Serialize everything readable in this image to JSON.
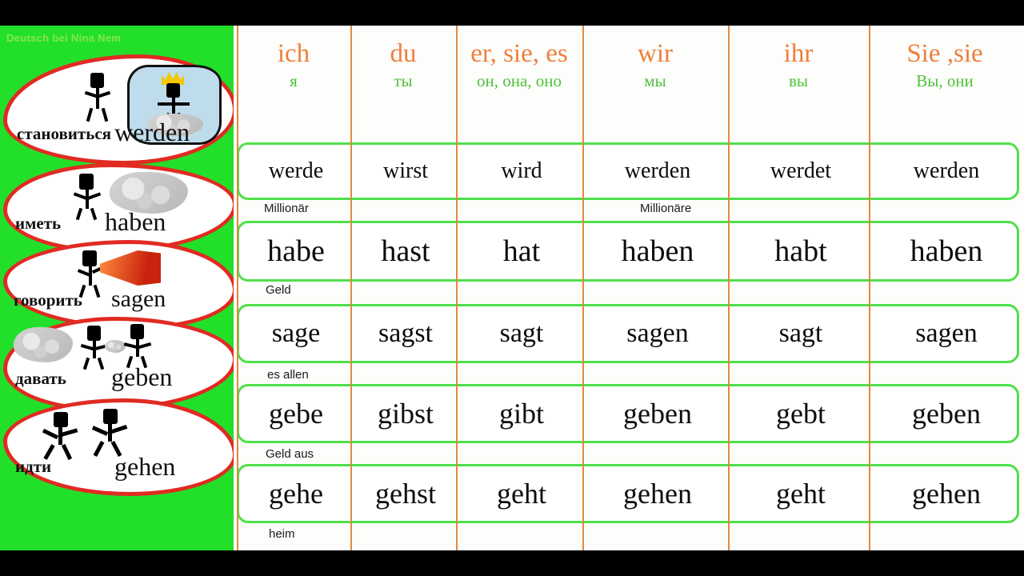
{
  "watermark": "Deutsch bei Nina Nem",
  "colors": {
    "sidebar_green": "#22e02a",
    "pronoun_orange": "#ef7f3d",
    "russian_green": "#4fc23a",
    "row_border_green": "#4fe04a",
    "column_divider": "#e08a3c",
    "card_outline_red": "#e02b22"
  },
  "header": {
    "columns": [
      {
        "pronoun": "ich",
        "russian": "я"
      },
      {
        "pronoun": "du",
        "russian": "ты"
      },
      {
        "pronoun": "er, sie, es",
        "russian": "он, она, оно"
      },
      {
        "pronoun": "wir",
        "russian": "мы"
      },
      {
        "pronoun": "ihr",
        "russian": "вы"
      },
      {
        "pronoun": "Sie ,sie",
        "russian": "Вы, они"
      }
    ]
  },
  "verbs": [
    {
      "infinitive": "werden",
      "russian": "становиться",
      "icon": "stick-figure-thinking-of-crowned-millionaire",
      "forms": [
        "werde",
        "wirst",
        "wird",
        "werden",
        "werdet",
        "werden"
      ],
      "notes": [
        {
          "text": "Millionär",
          "column": 0
        },
        {
          "text": "Millionäre",
          "column": 3
        }
      ]
    },
    {
      "infinitive": "haben",
      "russian": "иметь",
      "icon": "stick-figure-with-money",
      "forms": [
        "habe",
        "hast",
        "hat",
        "haben",
        "habt",
        "haben"
      ],
      "notes": [
        {
          "text": "Geld",
          "column": 0
        }
      ]
    },
    {
      "infinitive": "sagen",
      "russian": "говорить",
      "icon": "stick-figure-with-megaphone",
      "forms": [
        "sage",
        "sagst",
        "sagt",
        "sagen",
        "sagt",
        "sagen"
      ],
      "notes": [
        {
          "text": "es allen",
          "column": 0
        }
      ]
    },
    {
      "infinitive": "geben",
      "russian": "давать",
      "icon": "two-stick-figures-exchanging-money",
      "forms": [
        "gebe",
        "gibst",
        "gibt",
        "geben",
        "gebt",
        "geben"
      ],
      "notes": [
        {
          "text": "Geld aus",
          "column": 0
        }
      ]
    },
    {
      "infinitive": "gehen",
      "russian": "идти",
      "icon": "two-walking-stick-figures",
      "forms": [
        "gehe",
        "gehst",
        "geht",
        "gehen",
        "geht",
        "gehen"
      ],
      "notes": [
        {
          "text": "heim",
          "column": 0
        }
      ]
    }
  ]
}
